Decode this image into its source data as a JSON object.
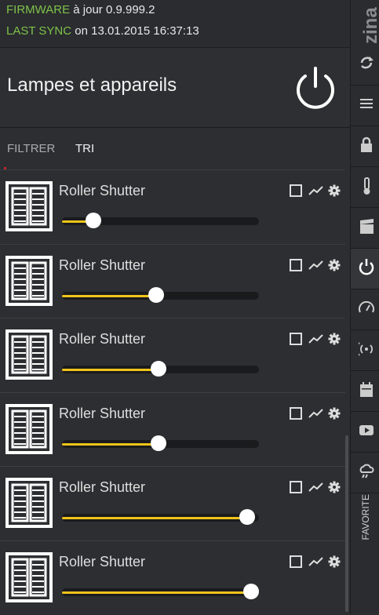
{
  "status": {
    "firmware_key": "FIRMWARE",
    "firmware_value": "à jour 0.9.999.2",
    "sync_key": "LAST SYNC",
    "sync_value": "on 13.01.2015 16:37:13"
  },
  "header": {
    "title": "Lampes et appareils",
    "power_icon": "power-icon"
  },
  "filters": {
    "filter_label": "FILTRER",
    "sort_label": "TRI"
  },
  "devices": [
    {
      "title": "Roller Shutter",
      "level": 0.16
    },
    {
      "title": "Roller Shutter",
      "level": 0.48
    },
    {
      "title": "Roller Shutter",
      "level": 0.49
    },
    {
      "title": "Roller Shutter",
      "level": 0.49
    },
    {
      "title": "Roller Shutter",
      "level": 0.94
    },
    {
      "title": "Roller Shutter",
      "level": 0.96
    }
  ],
  "rail": {
    "logo": "zina",
    "favorite_label": "FAVORITE",
    "icons": [
      "sync-icon",
      "menu-icon",
      "lock-icon",
      "thermometer-icon",
      "clapper-icon",
      "power-icon",
      "gauge-icon",
      "radio-signal-icon",
      "calendar-icon",
      "play-icon",
      "cloud-rain-icon"
    ]
  },
  "colors": {
    "accent": "#f0c419",
    "status_key": "#7fc24a",
    "filter_active_marker": "#c0262a"
  }
}
